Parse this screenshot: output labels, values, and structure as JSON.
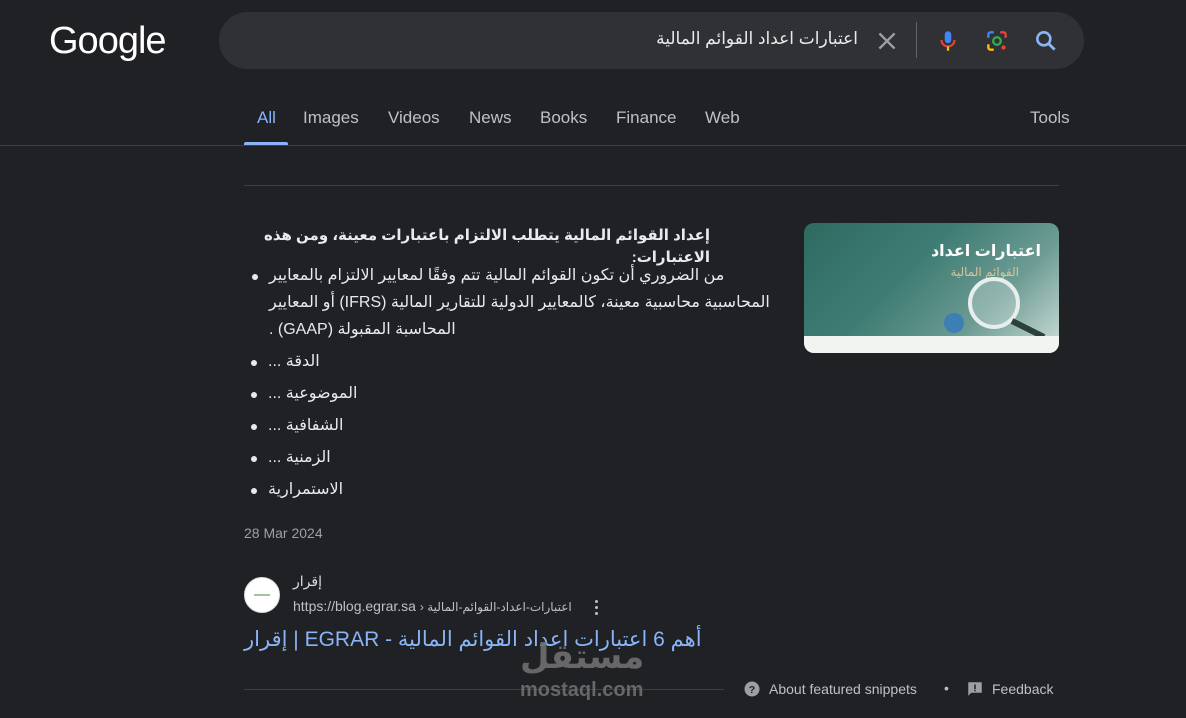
{
  "header": {
    "logo": "Google",
    "search": {
      "query": "اعتبارات اعداد القوائم المالية"
    },
    "icons": [
      "clear-icon",
      "mic-icon",
      "lens-icon",
      "search-icon"
    ]
  },
  "tabs": [
    {
      "label": "All",
      "active": true
    },
    {
      "label": "Images"
    },
    {
      "label": "Videos"
    },
    {
      "label": "News"
    },
    {
      "label": "Books"
    },
    {
      "label": "Finance"
    },
    {
      "label": "Web"
    }
  ],
  "tools_label": "Tools",
  "snippet": {
    "heading": "إعداد القوائم المالية يتطلب الالتزام باعتبارات معينة، ومن هذه الاعتبارات:",
    "bullets": [
      "من الضروري أن تكون القوائم المالية تتم وفقًا لمعايير الالتزام بالمعايير المحاسبية محاسبية معينة، كالمعايير الدولية للتقارير المالية (IFRS) أو المعايير المحاسبة المقبولة (GAAP) .",
      "الدقة ...",
      "الموضوعية ...",
      "الشفافية ...",
      "الزمنية ...",
      "الاستمرارية"
    ],
    "thumbnail": {
      "title": "اعتبارات اعداد",
      "subtitle": "القوائم المالية"
    },
    "date": "28 Mar 2024"
  },
  "result": {
    "site_name": "إقرار",
    "url": "https://blog.egrar.sa",
    "breadcrumb": "› اعتبارات-اعداد-القوائم-المالية",
    "title": "أهم 6 اعتبارات اعداد القوائم المالية - EGRAR | إقرار"
  },
  "footer": {
    "about": "About featured snippets",
    "separator": "•",
    "feedback": "Feedback"
  },
  "watermark": {
    "arabic": "مستقل",
    "latin": "mostaql.com"
  },
  "colors": {
    "background": "#202124",
    "link": "#8ab4f8",
    "text": "#e8eaed"
  }
}
